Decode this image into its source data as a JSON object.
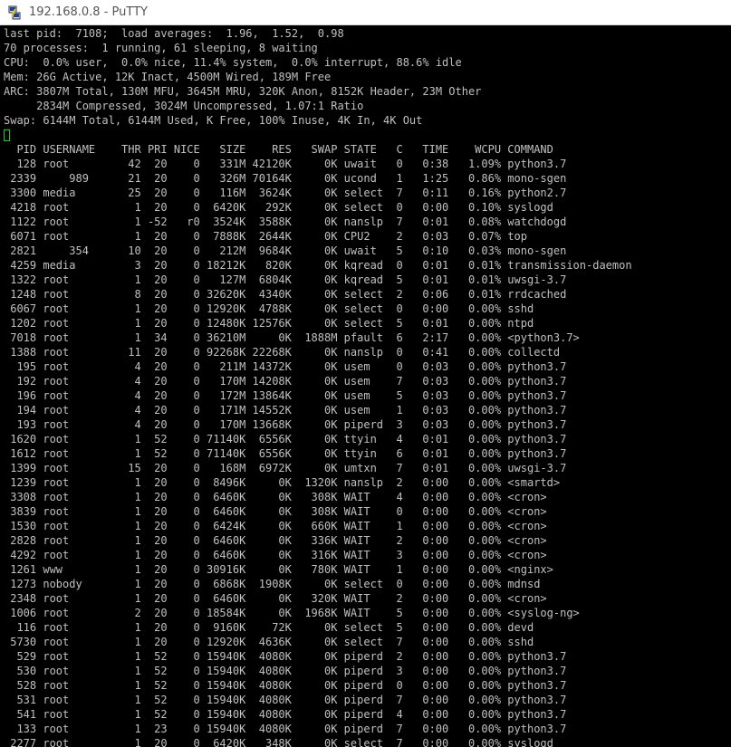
{
  "window": {
    "title": "192.168.0.8 - PuTTY",
    "icon": "putty-icon"
  },
  "summary": [
    "last pid:  7108;  load averages:  1.96,  1.52,  0.98",
    "70 processes:  1 running, 61 sleeping, 8 waiting",
    "CPU:  0.0% user,  0.0% nice, 11.4% system,  0.0% interrupt, 88.6% idle",
    "Mem: 26G Active, 12K Inact, 4500M Wired, 189M Free",
    "ARC: 3807M Total, 130M MFU, 3645M MRU, 320K Anon, 8152K Header, 23M Other",
    "     2834M Compressed, 3024M Uncompressed, 1.07:1 Ratio",
    "Swap: 6144M Total, 6144M Used, K Free, 100% Inuse, 4K In, 4K Out"
  ],
  "process_header": "  PID USERNAME    THR PRI NICE   SIZE    RES   SWAP STATE   C   TIME    WCPU COMMAND",
  "processes": [
    "  128 root         42  20    0   331M 42120K     0K uwait   0   0:38   1.09% python3.7",
    " 2339     989      21  20    0   326M 70164K     0K ucond   1   1:25   0.86% mono-sgen",
    " 3300 media        25  20    0   116M  3624K     0K select  7   0:11   0.16% python2.7",
    " 4218 root          1  20    0  6420K   292K     0K select  0   0:00   0.10% syslogd",
    " 1122 root          1 -52   r0  3524K  3588K     0K nanslp  7   0:01   0.08% watchdogd",
    " 6071 root          1  20    0  7888K  2644K     0K CPU2    2   0:03   0.07% top",
    " 2821     354      10  20    0   212M  9684K     0K uwait   5   0:10   0.03% mono-sgen",
    " 4259 media         3  20    0 18212K   820K     0K kqread  0   0:01   0.01% transmission-daemon",
    " 1322 root          1  20    0   127M  6804K     0K kqread  5   0:01   0.01% uwsgi-3.7",
    " 1248 root          8  20    0 32620K  4340K     0K select  2   0:06   0.01% rrdcached",
    " 6067 root          1  20    0 12920K  4788K     0K select  0   0:00   0.00% sshd",
    " 1202 root          1  20    0 12480K 12576K     0K select  5   0:01   0.00% ntpd",
    " 7018 root          1  34    0 36210M     0K  1888M pfault  6   2:17   0.00% <python3.7>",
    " 1388 root         11  20    0 92268K 22268K     0K nanslp  0   0:41   0.00% collectd",
    "  195 root          4  20    0   211M 14372K     0K usem    0   0:03   0.00% python3.7",
    "  192 root          4  20    0   170M 14208K     0K usem    7   0:03   0.00% python3.7",
    "  196 root          4  20    0   172M 13864K     0K usem    5   0:03   0.00% python3.7",
    "  194 root          4  20    0   171M 14552K     0K usem    1   0:03   0.00% python3.7",
    "  193 root          4  20    0   170M 13668K     0K piperd  3   0:03   0.00% python3.7",
    " 1620 root          1  52    0 71140K  6556K     0K ttyin   4   0:01   0.00% python3.7",
    " 1612 root          1  52    0 71140K  6556K     0K ttyin   6   0:01   0.00% python3.7",
    " 1399 root         15  20    0   168M  6972K     0K umtxn   7   0:01   0.00% uwsgi-3.7",
    " 1239 root          1  20    0  8496K     0K  1320K nanslp  2   0:00   0.00% <smartd>",
    " 3308 root          1  20    0  6460K     0K   308K WAIT    4   0:00   0.00% <cron>",
    " 3839 root          1  20    0  6460K     0K   308K WAIT    0   0:00   0.00% <cron>",
    " 1530 root          1  20    0  6424K     0K   660K WAIT    1   0:00   0.00% <cron>",
    " 2828 root          1  20    0  6460K     0K   336K WAIT    2   0:00   0.00% <cron>",
    " 4292 root          1  20    0  6460K     0K   316K WAIT    3   0:00   0.00% <cron>",
    " 1261 www           1  20    0 30916K     0K   780K WAIT    1   0:00   0.00% <nginx>",
    " 1273 nobody        1  20    0  6868K  1908K     0K select  0   0:00   0.00% mdnsd",
    " 2348 root          1  20    0  6460K     0K   320K WAIT    2   0:00   0.00% <cron>",
    " 1006 root          2  20    0 18584K     0K  1968K WAIT    5   0:00   0.00% <syslog-ng>",
    "  116 root          1  20    0  9160K    72K     0K select  5   0:00   0.00% devd",
    " 5730 root          1  20    0 12920K  4636K     0K select  7   0:00   0.00% sshd",
    "  529 root          1  52    0 15940K  4080K     0K piperd  2   0:00   0.00% python3.7",
    "  530 root          1  52    0 15940K  4080K     0K piperd  3   0:00   0.00% python3.7",
    "  528 root          1  52    0 15940K  4080K     0K piperd  0   0:00   0.00% python3.7",
    "  531 root          1  52    0 15940K  4080K     0K piperd  7   0:00   0.00% python3.7",
    "  541 root          1  52    0 15940K  4080K     0K piperd  4   0:00   0.00% python3.7",
    "  133 root          1  23    0 15940K  4080K     0K piperd  7   0:00   0.00% python3.7",
    " 2277 root          1  20    0  6420K   348K     0K select  7   0:00   0.00% syslogd"
  ]
}
